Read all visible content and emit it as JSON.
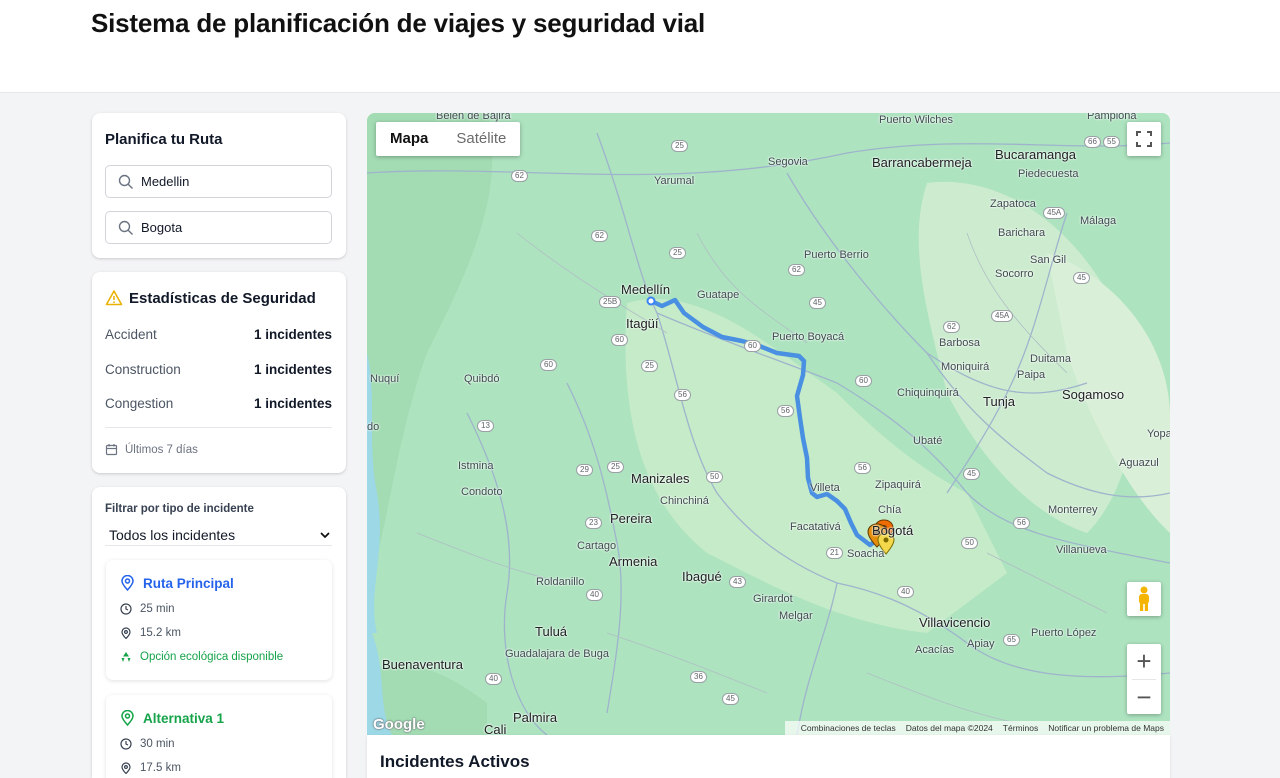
{
  "header": {
    "title": "Sistema de planificación de viajes y seguridad vial"
  },
  "planner": {
    "title": "Planifica tu Ruta",
    "origin": "Medellin",
    "destination": "Bogota"
  },
  "stats": {
    "title": "Estadísticas de Seguridad",
    "rows": [
      {
        "label": "Accident",
        "value": "1 incidentes"
      },
      {
        "label": "Construction",
        "value": "1 incidentes"
      },
      {
        "label": "Congestion",
        "value": "1 incidentes"
      }
    ],
    "period": "Últimos 7 días",
    "accent": "#eab308"
  },
  "filter": {
    "label": "Filtrar por tipo de incidente",
    "selected": "Todos los incidentes"
  },
  "routes": [
    {
      "name": "Ruta Principal",
      "time": "25 min",
      "distance": "15.2 km",
      "eco": "Opción ecológica disponible",
      "color": "#2563eb"
    },
    {
      "name": "Alternativa 1",
      "time": "30 min",
      "distance": "17.5 km",
      "color": "#16a34a"
    }
  ],
  "map": {
    "type_map": "Mapa",
    "type_satellite": "Satélite",
    "zoom_in": "+",
    "zoom_out": "−",
    "logo": "Google",
    "attribution": [
      "Combinaciones de teclas",
      "Datos del mapa ©2024",
      "Términos",
      "Notificar un problema de Maps"
    ],
    "route_color": "#4a90e2",
    "labels": {
      "medellin": "Medellín",
      "itagui": "Itagüí",
      "guatape": "Guatape",
      "yarumal": "Yarumal",
      "segovia": "Segovia",
      "barranca": "Barrancabermeja",
      "bucaramanga": "Bucaramanga",
      "piedecuesta": "Piedecuesta",
      "zapatoca": "Zapatoca",
      "malaga": "Málaga",
      "barichara": "Barichara",
      "sangil": "San Gil",
      "socorro": "Socorro",
      "pberrio": "Puerto Berrio",
      "pboyaca": "Puerto Boyacá",
      "barbosa": "Barbosa",
      "moniquira": "Moniquirá",
      "duitama": "Duitama",
      "paipa": "Paipa",
      "sogamoso": "Sogamoso",
      "tunja": "Tunja",
      "chiquinquira": "Chiquinquirá",
      "ubate": "Ubaté",
      "yopal": "Yopal",
      "aguazul": "Aguazul",
      "zipaquira": "Zipaquirá",
      "chia": "Chía",
      "bogota": "Bogotá",
      "soacha": "Soacha",
      "facatativa": "Facatativá",
      "villeta": "Villeta",
      "monterrey": "Monterrey",
      "villanueva": "Villanueva",
      "villavicencio": "Villavicencio",
      "acacias": "Acacías",
      "apiay": "Apiay",
      "plopez": "Puerto López",
      "girardot": "Girardot",
      "melgar": "Melgar",
      "ibague": "Ibagué",
      "manizales": "Manizales",
      "pereira": "Pereira",
      "armenia": "Armenia",
      "chinchina": "Chinchiná",
      "cartago": "Cartago",
      "roldanillo": "Roldanillo",
      "tulua": "Tuluá",
      "buga": "Guadalajara de Buga",
      "palmira": "Palmira",
      "cali": "Cali",
      "buenaventura": "Buenaventura",
      "quibdo": "Quibdó",
      "nuqui": "Nuquí",
      "istmina": "Istmina",
      "condoto": "Condoto",
      "pwilches": "Puerto Wilches",
      "pamplona": "Pamplona",
      "belen": "Belen de Bajira",
      "do": "do"
    }
  },
  "incidents": {
    "title": "Incidentes Activos"
  }
}
